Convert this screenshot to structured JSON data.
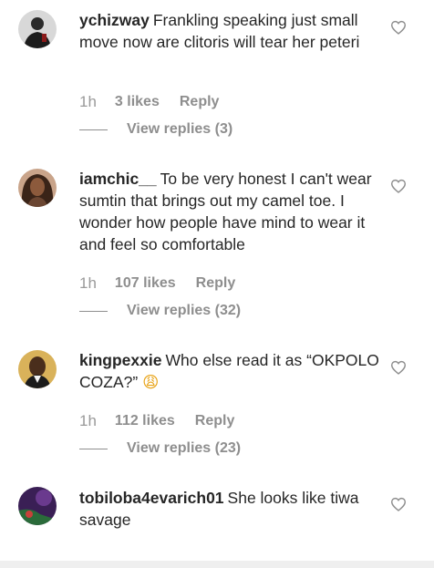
{
  "comments": [
    {
      "username": "ychizway",
      "text": "Frankling speaking just small move now are clitoris will tear her peteri",
      "time": "1h",
      "likes": "3 likes",
      "reply": "Reply",
      "view_replies": "View replies (3)"
    },
    {
      "username": "iamchic__",
      "text": "To be very honest I can't wear sumtin that brings out my camel toe. I wonder how people have mind to wear it and feel so comfortable",
      "time": "1h",
      "likes": "107 likes",
      "reply": "Reply",
      "view_replies": "View replies (32)"
    },
    {
      "username": "kingpexxie",
      "text": "Who else read it as “OKPOLO COZA?”",
      "emoji": "😩",
      "time": "1h",
      "likes": "112 likes",
      "reply": "Reply",
      "view_replies": "View replies (23)"
    },
    {
      "username": "tobiloba4evarich01",
      "text": "She looks like tiwa savage"
    }
  ],
  "icons": {
    "like": "heart-outline-icon"
  },
  "colors": {
    "text": "#262626",
    "secondary": "#8e8e8e",
    "footer": "#efefef"
  }
}
